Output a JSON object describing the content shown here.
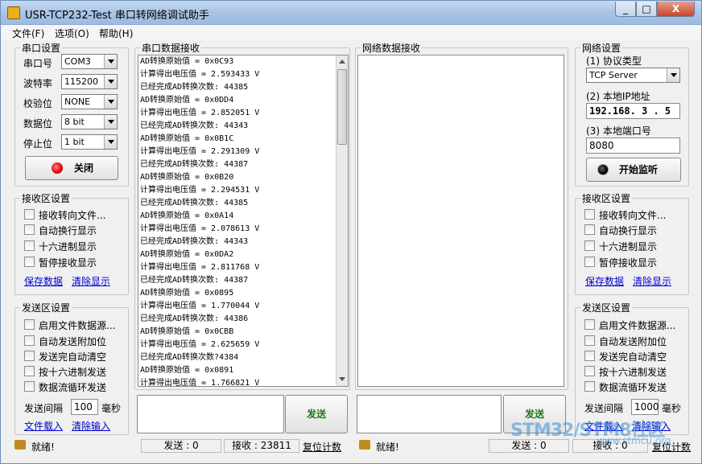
{
  "window": {
    "title": "USR-TCP232-Test 串口转网络调试助手",
    "min": "_",
    "max": "□",
    "close": "X"
  },
  "menu": [
    "文件(F)",
    "选项(O)",
    "帮助(H)"
  ],
  "serial_settings": {
    "legend": "串口设置",
    "fields": [
      {
        "label": "串口号",
        "value": "COM3"
      },
      {
        "label": "波特率",
        "value": "115200"
      },
      {
        "label": "校验位",
        "value": "NONE"
      },
      {
        "label": "数据位",
        "value": "8 bit"
      },
      {
        "label": "停止位",
        "value": "1 bit"
      }
    ],
    "toggle_button": "关闭",
    "led_color": "#e00000"
  },
  "left_recv": {
    "legend": "接收区设置",
    "options": [
      "接收转向文件...",
      "自动换行显示",
      "十六进制显示",
      "暂停接收显示"
    ],
    "save": "保存数据",
    "clear": "清除显示"
  },
  "left_send": {
    "legend": "发送区设置",
    "options": [
      "启用文件数据源...",
      "自动发送附加位",
      "发送完自动清空",
      "按十六进制发送",
      "数据流循环发送"
    ],
    "interval_label": "发送间隔",
    "interval_value": "100",
    "interval_unit": "毫秒",
    "load": "文件载入",
    "clear": "清除输入"
  },
  "serial_recv": {
    "legend": "串口数据接收",
    "lines": [
      "AD转换原始值 = 0x0C93",
      "计算得出电压值 = 2.593433 V",
      "已经完成AD转换次数: 44385",
      "AD转换原始值 = 0x0DD4",
      "计算得出电压值 = 2.852051 V",
      "已经完成AD转换次数: 44343",
      "AD转换原始值 = 0x0B1C",
      "计算得出电压值 = 2.291309 V",
      "已经完成AD转换次数: 44387",
      "AD转换原始值 = 0x0B20",
      "计算得出电压值 = 2.294531 V",
      "已经完成AD转换次数: 44385",
      "AD转换原始值 = 0x0A14",
      "计算得出电压值 = 2.078613 V",
      "已经完成AD转换次数: 44343",
      "AD转换原始值 = 0x0DA2",
      "计算得出电压值 = 2.811768 V",
      "已经完成AD转换次数: 44387",
      "AD转换原始值 = 0x0895",
      "计算得出电压值 = 1.770044 V",
      "已经完成AD转换次数: 44386",
      "AD转换原始值 = 0x0CBB",
      "计算得出电压值 = 2.625659 V",
      "已经完成AD转换次数?4384",
      "AD转换原始值 = 0x0891",
      "计算得出电压值 = 1.766821 V"
    ]
  },
  "net_recv": {
    "legend": "网络数据接收"
  },
  "send_button": "发送",
  "net_settings": {
    "legend": "网络设置",
    "protocol_label": "(1) 协议类型",
    "protocol_value": "TCP Server",
    "ip_label": "(2) 本地IP地址",
    "ip_value": "192.168. 3 . 5",
    "port_label": "(3) 本地端口号",
    "port_value": "8080",
    "listen_button": "开始监听"
  },
  "right_recv": {
    "legend": "接收区设置",
    "options": [
      "接收转向文件...",
      "自动换行显示",
      "十六进制显示",
      "暂停接收显示"
    ],
    "save": "保存数据",
    "clear": "清除显示"
  },
  "right_send": {
    "legend": "发送区设置",
    "options": [
      "启用文件数据源...",
      "自动发送附加位",
      "发送完自动清空",
      "按十六进制发送",
      "数据流循环发送"
    ],
    "interval_label": "发送间隔",
    "interval_value": "1000",
    "interval_unit": "毫秒",
    "load": "文件载入",
    "clear": "清除输入"
  },
  "status_left": {
    "ready": "就绪!",
    "sent": "发送 : 0",
    "received": "接收 : 23811",
    "reset": "复位计数"
  },
  "status_right": {
    "ready": "就绪!",
    "sent": "发送 : 0",
    "received": "接收 : 0",
    "reset": "复位计数"
  },
  "watermark": {
    "text": "STM32/STM8社区",
    "url": "www.stmcu.org"
  }
}
